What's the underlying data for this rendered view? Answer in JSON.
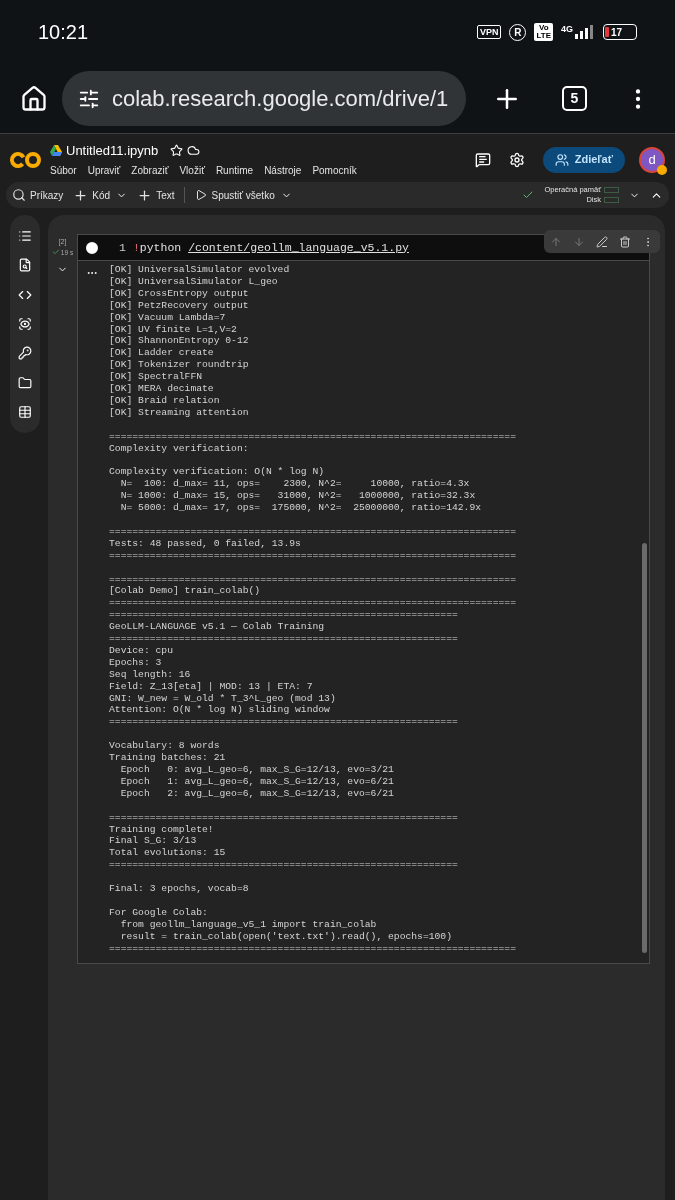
{
  "status_bar": {
    "time": "10:21",
    "vpn": "VPN",
    "registered": "R",
    "volte": [
      "Vo",
      "LTE"
    ],
    "network": "4G",
    "battery": "17"
  },
  "browser": {
    "url": "colab.research.google.com/drive/1",
    "tab_count": "5"
  },
  "notebook": {
    "title": "Untitled11.ipynb",
    "menu": [
      "Súbor",
      "Upraviť",
      "Zobraziť",
      "Vložiť",
      "Runtime",
      "Nástroje",
      "Pomocník"
    ],
    "share": "Zdieľať",
    "avatar": "d"
  },
  "toolbar": {
    "items": [
      {
        "kind": "search",
        "label": "Príkazy",
        "dropdown": false
      },
      {
        "kind": "add",
        "label": "Kód",
        "dropdown": true
      },
      {
        "kind": "add",
        "label": "Text",
        "dropdown": false
      },
      {
        "kind": "run",
        "label": "Spustiť všetko",
        "dropdown": true
      }
    ],
    "resources": [
      "Operačná pamäť",
      "Disk"
    ]
  },
  "sidebar": {
    "items": [
      {
        "kind": "toc"
      },
      {
        "kind": "find"
      },
      {
        "kind": "code"
      },
      {
        "kind": "variables"
      },
      {
        "kind": "secrets"
      },
      {
        "kind": "files"
      },
      {
        "kind": "data"
      }
    ]
  },
  "cell": {
    "execution_count": "[2]",
    "duration": "19 s",
    "line_number": "1",
    "code_prefix": "!",
    "code": "python ",
    "path": "/content/geollm_language_v5.1.py",
    "output_blocks": [
      [
        "[OK] UniversalSimulator evolved",
        "[OK] UniversalSimulator L_geo",
        "[OK] CrossEntropy output",
        "[OK] PetzRecovery output",
        "[OK] Vacuum Lambda=7",
        "[OK] UV finite L=1,V=2",
        "[OK] ShannonEntropy 0-12",
        "[OK] Ladder create",
        "[OK] Tokenizer roundtrip",
        "[OK] SpectralFFN",
        "[OK] MERA decimate",
        "[OK] Braid relation",
        "[OK] Streaming attention"
      ],
      [
        "======================================================================",
        "Complexity verification:"
      ],
      [
        "Complexity verification: O(N * log N)",
        "  N=  100: d_max= 11, ops=    2300, N^2=     10000, ratio=4.3x",
        "  N= 1000: d_max= 15, ops=   31000, N^2=   1000000, ratio=32.3x",
        "  N= 5000: d_max= 17, ops=  175000, N^2=  25000000, ratio=142.9x"
      ],
      [
        "======================================================================",
        "Tests: 48 passed, 0 failed, 13.9s",
        "======================================================================"
      ],
      [
        "======================================================================",
        "[Colab Demo] train_colab()",
        "======================================================================",
        "============================================================",
        "GeoLLM-LANGUAGE v5.1 — Colab Training",
        "============================================================",
        "Device: cpu",
        "Epochs: 3",
        "Seq length: 16",
        "Field: Z_13[eta] | MOD: 13 | ETA: 7",
        "GNI: W_new = W_old * T_3^L_geo (mod 13)",
        "Attention: O(N * log N) sliding window",
        "============================================================"
      ],
      [
        "Vocabulary: 8 words",
        "Training batches: 21",
        "  Epoch   0: avg_L_geo=6, max_S_G=12/13, evo=3/21",
        "  Epoch   1: avg_L_geo=6, max_S_G=12/13, evo=6/21",
        "  Epoch   2: avg_L_geo=6, max_S_G=12/13, evo=6/21"
      ],
      [
        "============================================================",
        "Training complete!",
        "Final S_G: 3/13",
        "Total evolutions: 15",
        "============================================================"
      ],
      [
        "Final: 3 epochs, vocab=8"
      ],
      [
        "For Google Colab:",
        "  from geollm_language_v5_1 import train_colab",
        "  result = train_colab(open('text.txt').read(), epochs=100)",
        "======================================================================"
      ]
    ]
  }
}
